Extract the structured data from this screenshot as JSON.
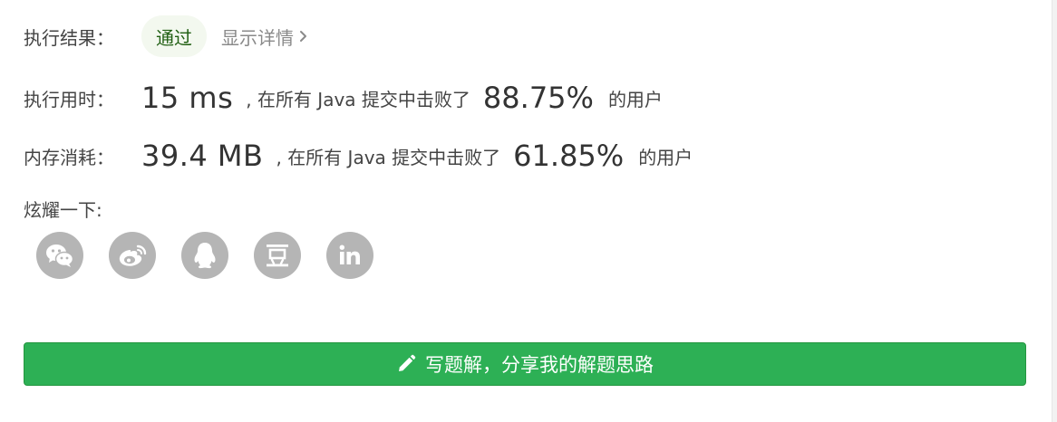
{
  "result": {
    "label": "执行结果：",
    "status": "通过",
    "detail_link": "显示详情"
  },
  "runtime": {
    "label": "执行用时：",
    "value": "15 ms",
    "beat_text": ", 在所有 Java 提交中击败了",
    "percent": "88.75%",
    "suffix": "的用户"
  },
  "memory": {
    "label": "内存消耗：",
    "value": "39.4 MB",
    "beat_text": ", 在所有 Java 提交中击败了",
    "percent": "61.85%",
    "suffix": "的用户"
  },
  "share": {
    "label": "炫耀一下:",
    "icons": [
      "wechat-icon",
      "weibo-icon",
      "qq-icon",
      "douban-icon",
      "linkedin-icon"
    ],
    "douban_glyph": "豆",
    "linkedin_glyph": "in"
  },
  "cta": {
    "label": "写题解，分享我的解题思路"
  },
  "colors": {
    "accent_green": "#2db055",
    "badge_bg": "#f3f8ef",
    "badge_text": "#1f5e11",
    "icon_grey": "#b5b5b5"
  }
}
